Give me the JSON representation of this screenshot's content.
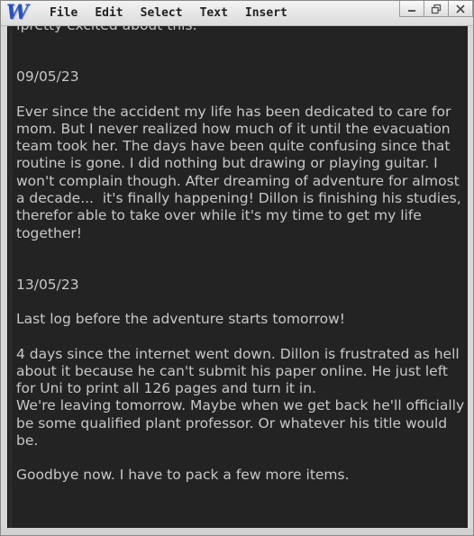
{
  "app": {
    "logo_text": "W"
  },
  "menu": {
    "items": [
      "File",
      "Edit",
      "Select",
      "Text",
      "Insert"
    ]
  },
  "window_controls": {
    "minimize_icon": "minimize-icon",
    "restore_icon": "restore-icon",
    "close_icon": "close-icon"
  },
  "document": {
    "top_partial_line": "Ipretty excited about this.",
    "entries": [
      {
        "date": "09/05/23",
        "paragraphs": [
          "Ever since the accident my life has been dedicated to care for mom. But I never realized how much of it until the evacuation team took her. The days have been quite confusing since that routine is gone. I did nothing but drawing or playing guitar. I won't complain though. After dreaming of adventure for almost a decade...  it's finally happening! Dillon is finishing his studies, therefor able to take over while it's my time to get my life together!"
        ]
      },
      {
        "date": "13/05/23",
        "paragraphs": [
          "Last log before the adventure starts tomorrow!",
          "4 days since the internet went down. Dillon is frustrated as hell about it because he can't submit his paper online. He just left for Uni to print all 126 pages and turn it in.\nWe're leaving tomorrow. Maybe when we get back he'll officially be some qualified plant professor. Or whatever his title would be.",
          "Goodbye now. I have to pack a few more items."
        ]
      }
    ]
  },
  "colors": {
    "editor_background": "#232323",
    "text": "#c8c8c8",
    "logo": "#2b4fb3"
  }
}
